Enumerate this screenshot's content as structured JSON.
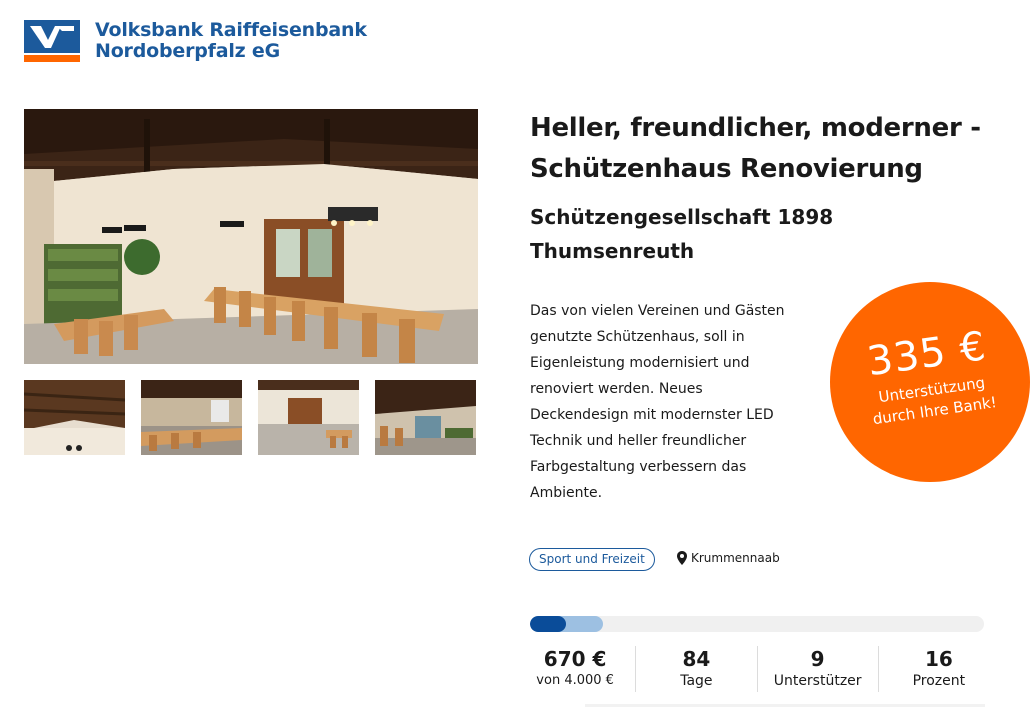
{
  "bank": {
    "name_line1": "Volksbank Raiffeisenbank",
    "name_line2": "Nordoberpfalz eG",
    "logo_icon": "vr-logo-icon",
    "brand_blue": "#1c5a9c",
    "brand_orange": "#ff6600"
  },
  "gallery": {
    "main_image": "hall-interior-image",
    "thumbnails": [
      "ceiling-image",
      "dining-tables-image",
      "hall-room-image",
      "bar-area-image"
    ]
  },
  "project": {
    "title": "Heller, freundlicher, moderner - Schützenhaus Renovierung",
    "organization": "Schützengesellschaft 1898 Thumsenreuth",
    "description": "Das von vielen Vereinen und Gästen genutzte Schützenhaus, soll in Eigenleistung modernisiert und renoviert werden. Neues Deckendesign mit modernster LED Technik und heller freundlicher Farbgestaltung verbessern das Ambiente.",
    "category_tag": "Sport und Freizeit",
    "location": "Krummennaab",
    "location_icon": "map-pin-icon"
  },
  "badge": {
    "amount": "335 €",
    "label_line1": "Unterstützung",
    "label_line2": "durch Ihre Bank!"
  },
  "progress": {
    "funded_fraction": 0.08,
    "pledged_fraction": 0.16,
    "primary_color": "#0a4c99",
    "secondary_color": "#9dc0e2"
  },
  "stats": {
    "raised_value": "670 €",
    "raised_label": "von 4.000 €",
    "days_value": "84",
    "days_label": "Tage",
    "supporters_value": "9",
    "supporters_label": "Unterstützer",
    "percent_value": "16",
    "percent_label": "Prozent"
  }
}
